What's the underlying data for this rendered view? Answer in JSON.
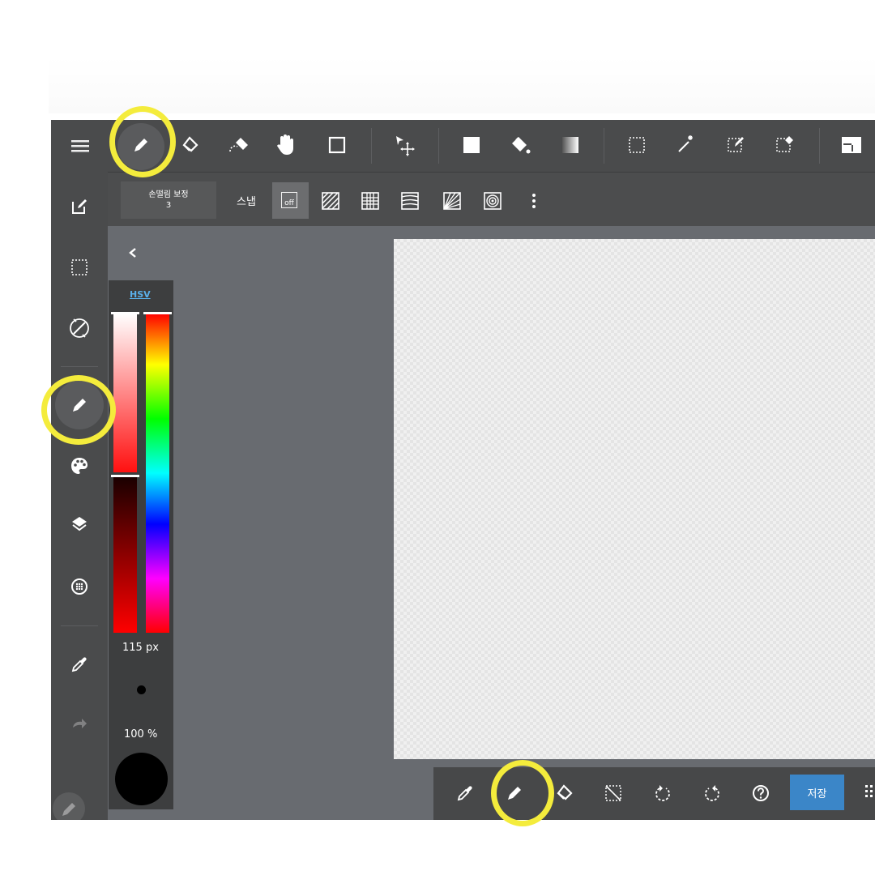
{
  "stabilizer": {
    "label": "손떨림 보정",
    "value": "3"
  },
  "snap": {
    "label": "스냅",
    "off_label": "off"
  },
  "color_panel": {
    "mode_label": "HSV",
    "brush_size": "115 px",
    "opacity": "100 %"
  },
  "bottom": {
    "save_label": "저장"
  },
  "colors": {
    "accent": "#3b86c8",
    "highlight": "#f4ec3c",
    "current_color": "#000000"
  },
  "icons": {
    "top": [
      "menu-icon",
      "pen-icon",
      "eraser-icon",
      "soft-eraser-icon",
      "hand-icon",
      "shape-icon",
      "move-icon",
      "fill-square-icon",
      "bucket-icon",
      "gradient-icon",
      "select-rect-icon",
      "magic-wand-icon",
      "select-pen-icon",
      "select-eraser-icon",
      "layout-icon"
    ],
    "snap": [
      "parallel-snap-icon",
      "grid-snap-icon",
      "curve-snap-icon",
      "radial-snap-icon",
      "circle-snap-icon",
      "more-icon"
    ],
    "left": [
      "edit-icon",
      "selection-icon",
      "rotate-icon",
      "pen-icon",
      "palette-icon",
      "layers-icon",
      "materials-icon",
      "eyedropper-icon",
      "redo-icon",
      "undo-icon"
    ],
    "bottom": [
      "eyedropper-icon",
      "pen-icon",
      "eraser-icon",
      "deselect-icon",
      "undo-icon",
      "redo-icon",
      "help-icon",
      "grid-menu-icon"
    ]
  }
}
